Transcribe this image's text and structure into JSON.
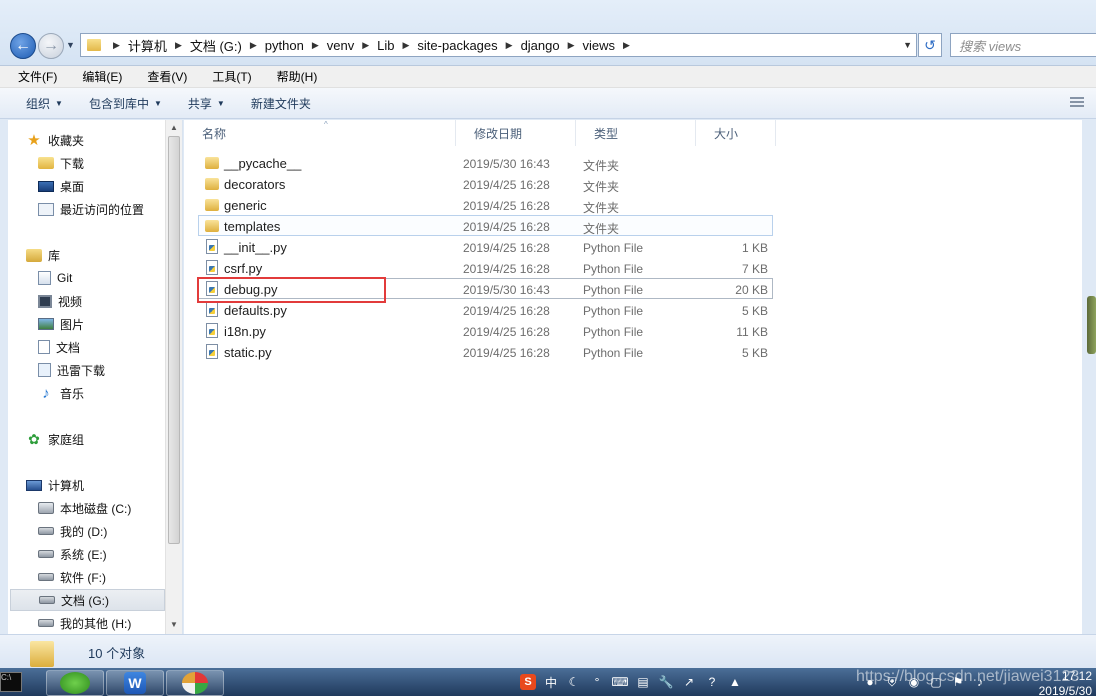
{
  "address_bar": {
    "breadcrumb": [
      "计算机",
      "文档 (G:)",
      "python",
      "venv",
      "Lib",
      "site-packages",
      "django",
      "views"
    ],
    "search_placeholder": "搜索 views"
  },
  "menu": [
    "文件(F)",
    "编辑(E)",
    "查看(V)",
    "工具(T)",
    "帮助(H)"
  ],
  "toolbar": {
    "organize": "组织",
    "include_in_library": "包含到库中",
    "share": "共享",
    "new_folder": "新建文件夹"
  },
  "sidebar": {
    "favorites": {
      "label": "收藏夹",
      "items": [
        "下载",
        "桌面",
        "最近访问的位置"
      ]
    },
    "libraries": {
      "label": "库",
      "items": [
        "Git",
        "视频",
        "图片",
        "文档",
        "迅雷下载",
        "音乐"
      ]
    },
    "homegroup": "家庭组",
    "computer": {
      "label": "计算机",
      "items": [
        "本地磁盘 (C:)",
        "我的 (D:)",
        "系统 (E:)",
        "软件 (F:)",
        "文档 (G:)",
        "我的其他 (H:)"
      ],
      "selected": "文档 (G:)"
    }
  },
  "columns": {
    "name": "名称",
    "modified": "修改日期",
    "type": "类型",
    "size": "大小"
  },
  "files": [
    {
      "name": "__pycache__",
      "modified": "2019/5/30 16:43",
      "type": "文件夹",
      "size": "",
      "kind": "folder"
    },
    {
      "name": "decorators",
      "modified": "2019/4/25 16:28",
      "type": "文件夹",
      "size": "",
      "kind": "folder"
    },
    {
      "name": "generic",
      "modified": "2019/4/25 16:28",
      "type": "文件夹",
      "size": "",
      "kind": "folder"
    },
    {
      "name": "templates",
      "modified": "2019/4/25 16:28",
      "type": "文件夹",
      "size": "",
      "kind": "folder"
    },
    {
      "name": "__init__.py",
      "modified": "2019/4/25 16:28",
      "type": "Python File",
      "size": "1 KB",
      "kind": "py"
    },
    {
      "name": "csrf.py",
      "modified": "2019/4/25 16:28",
      "type": "Python File",
      "size": "7 KB",
      "kind": "py"
    },
    {
      "name": "debug.py",
      "modified": "2019/5/30 16:43",
      "type": "Python File",
      "size": "20 KB",
      "kind": "py"
    },
    {
      "name": "defaults.py",
      "modified": "2019/4/25 16:28",
      "type": "Python File",
      "size": "5 KB",
      "kind": "py"
    },
    {
      "name": "i18n.py",
      "modified": "2019/4/25 16:28",
      "type": "Python File",
      "size": "11 KB",
      "kind": "py"
    },
    {
      "name": "static.py",
      "modified": "2019/4/25 16:28",
      "type": "Python File",
      "size": "5 KB",
      "kind": "py"
    }
  ],
  "status": {
    "item_count": "10 个对象"
  },
  "taskbar": {
    "clock_time": "17:12",
    "clock_date": "2019/5/30",
    "tray_ime": "中",
    "watermark": "https://blog.csdn.net/jiawei3123"
  },
  "colors": {
    "highlight_box": "#e23b3b",
    "selection_border": "#b9d1ec"
  }
}
